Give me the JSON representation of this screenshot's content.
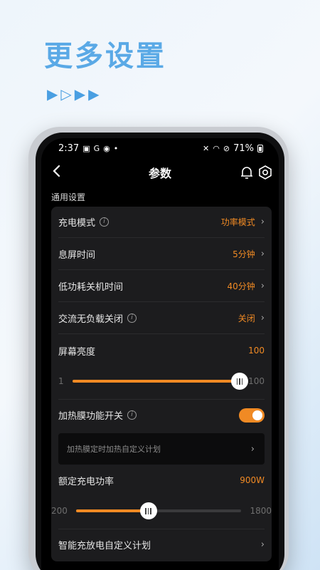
{
  "promo": {
    "title": "更多设置",
    "arrows": [
      "▶",
      "▷",
      "▶",
      "▶"
    ]
  },
  "status_bar": {
    "time": "2:37",
    "battery": "71%"
  },
  "app_bar": {
    "title": "参数"
  },
  "section": {
    "label": "通用设置"
  },
  "settings": {
    "charge_mode": {
      "label": "充电模式",
      "value": "功率模式"
    },
    "screen_off": {
      "label": "息屏时间",
      "value": "5分钟"
    },
    "low_power_shutdown": {
      "label": "低功耗关机时间",
      "value": "40分钟"
    },
    "ac_no_load_off": {
      "label": "交流无负载关闭",
      "value": "关闭"
    },
    "brightness": {
      "label": "屏幕亮度",
      "value": "100",
      "min": "1",
      "max": "100",
      "level": 100
    },
    "heating_film": {
      "label": "加热膜功能开关",
      "enabled": true
    },
    "heating_plan": {
      "label": "加热膜定时加热自定义计划"
    },
    "rated_power": {
      "label": "额定充电功率",
      "value": "900W",
      "min": "200",
      "max": "1800",
      "level": 900
    },
    "smart_plan": {
      "label": "智能充放电自定义计划"
    }
  },
  "colors": {
    "accent": "#f08a24",
    "promo_blue": "#5aa9e6"
  }
}
